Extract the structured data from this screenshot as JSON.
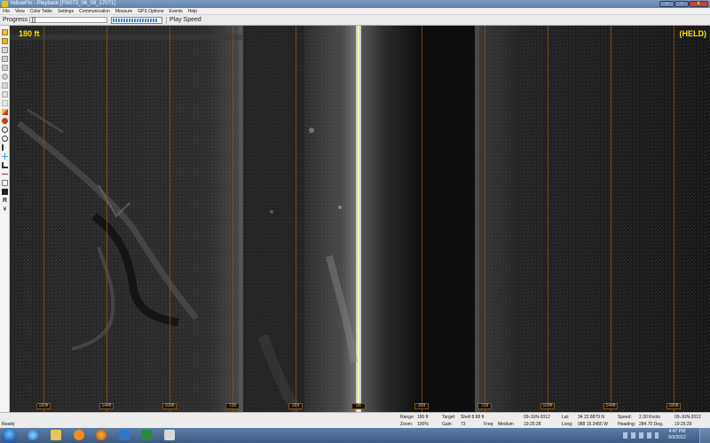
{
  "window": {
    "title": "YellowFin - Playback [FI0073_06_09_17071]",
    "minimize": "–",
    "maximize": "▫",
    "close": "x"
  },
  "menu": [
    "File",
    "View",
    "Color Table",
    "Settings",
    "Communication",
    "Measure",
    "GPS Options",
    "Events",
    "Help"
  ],
  "toolbar": {
    "progress_label": "Progress",
    "play_speed_label": "Play Speed",
    "play_speed_fraction": 0.95,
    "progress_fraction": 0.02
  },
  "sonar": {
    "range_label": "180 ft",
    "held_label": "(HELD)",
    "scale_ticks": [
      "180ft",
      "144ft",
      "108ft",
      "72ft",
      "36ft",
      "0ft",
      "36ft",
      "72ft",
      "108ft",
      "144ft",
      "180ft"
    ],
    "line_color": "#8a5010",
    "label_color": "#ffe000"
  },
  "status": {
    "range_label": "Range:",
    "range_value": "180 ft",
    "zoom_label": "Zoom:",
    "zoom_value": "100%",
    "target_label": "Target:",
    "target_value": "Shell 8.88 ft",
    "gain_label": "Gain:",
    "gain_value": "73",
    "freq_label": "Freq:",
    "freq_value": "Medium",
    "date_value": "09-JUN-2012",
    "time_value": "19:25:28",
    "lat_label": "Lat:",
    "lat_value": "34 22.8879 N",
    "long_label": "Long:",
    "long_value": "088 15.3455 W",
    "speed_label": "Speed:",
    "speed_value": "2.30 Knots",
    "heading_label": "Heading:",
    "heading_value": "284.70 Deg.",
    "date2_value": "09-JUN-2012",
    "time2_value": "19:25:29",
    "ready_text": "Ready"
  },
  "taskbar": {
    "clock_time": "4:47 PM",
    "clock_date": "6/9/2012",
    "apps": [
      "ie-icon",
      "folder-icon",
      "media-player-icon",
      "firefox-icon",
      "network-icon",
      "excel-icon",
      "yellowfin-icon"
    ]
  }
}
